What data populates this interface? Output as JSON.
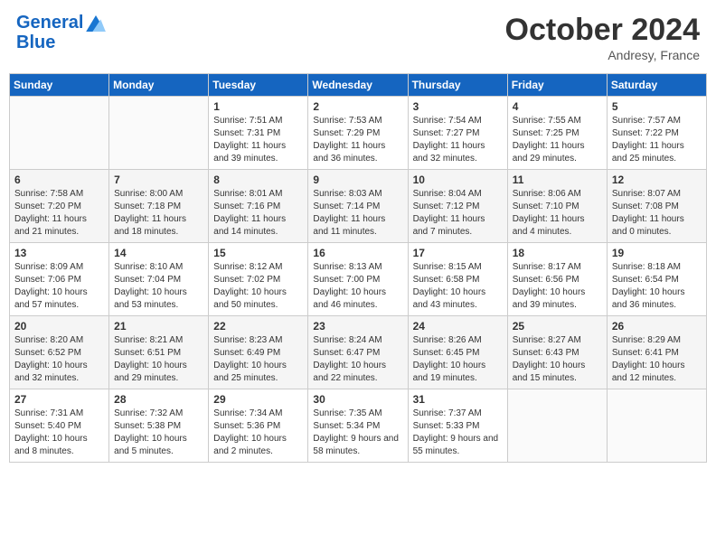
{
  "header": {
    "logo_line1": "General",
    "logo_line2": "Blue",
    "month": "October 2024",
    "location": "Andresy, France"
  },
  "weekdays": [
    "Sunday",
    "Monday",
    "Tuesday",
    "Wednesday",
    "Thursday",
    "Friday",
    "Saturday"
  ],
  "weeks": [
    [
      {
        "day": "",
        "info": ""
      },
      {
        "day": "",
        "info": ""
      },
      {
        "day": "1",
        "info": "Sunrise: 7:51 AM\nSunset: 7:31 PM\nDaylight: 11 hours and 39 minutes."
      },
      {
        "day": "2",
        "info": "Sunrise: 7:53 AM\nSunset: 7:29 PM\nDaylight: 11 hours and 36 minutes."
      },
      {
        "day": "3",
        "info": "Sunrise: 7:54 AM\nSunset: 7:27 PM\nDaylight: 11 hours and 32 minutes."
      },
      {
        "day": "4",
        "info": "Sunrise: 7:55 AM\nSunset: 7:25 PM\nDaylight: 11 hours and 29 minutes."
      },
      {
        "day": "5",
        "info": "Sunrise: 7:57 AM\nSunset: 7:22 PM\nDaylight: 11 hours and 25 minutes."
      }
    ],
    [
      {
        "day": "6",
        "info": "Sunrise: 7:58 AM\nSunset: 7:20 PM\nDaylight: 11 hours and 21 minutes."
      },
      {
        "day": "7",
        "info": "Sunrise: 8:00 AM\nSunset: 7:18 PM\nDaylight: 11 hours and 18 minutes."
      },
      {
        "day": "8",
        "info": "Sunrise: 8:01 AM\nSunset: 7:16 PM\nDaylight: 11 hours and 14 minutes."
      },
      {
        "day": "9",
        "info": "Sunrise: 8:03 AM\nSunset: 7:14 PM\nDaylight: 11 hours and 11 minutes."
      },
      {
        "day": "10",
        "info": "Sunrise: 8:04 AM\nSunset: 7:12 PM\nDaylight: 11 hours and 7 minutes."
      },
      {
        "day": "11",
        "info": "Sunrise: 8:06 AM\nSunset: 7:10 PM\nDaylight: 11 hours and 4 minutes."
      },
      {
        "day": "12",
        "info": "Sunrise: 8:07 AM\nSunset: 7:08 PM\nDaylight: 11 hours and 0 minutes."
      }
    ],
    [
      {
        "day": "13",
        "info": "Sunrise: 8:09 AM\nSunset: 7:06 PM\nDaylight: 10 hours and 57 minutes."
      },
      {
        "day": "14",
        "info": "Sunrise: 8:10 AM\nSunset: 7:04 PM\nDaylight: 10 hours and 53 minutes."
      },
      {
        "day": "15",
        "info": "Sunrise: 8:12 AM\nSunset: 7:02 PM\nDaylight: 10 hours and 50 minutes."
      },
      {
        "day": "16",
        "info": "Sunrise: 8:13 AM\nSunset: 7:00 PM\nDaylight: 10 hours and 46 minutes."
      },
      {
        "day": "17",
        "info": "Sunrise: 8:15 AM\nSunset: 6:58 PM\nDaylight: 10 hours and 43 minutes."
      },
      {
        "day": "18",
        "info": "Sunrise: 8:17 AM\nSunset: 6:56 PM\nDaylight: 10 hours and 39 minutes."
      },
      {
        "day": "19",
        "info": "Sunrise: 8:18 AM\nSunset: 6:54 PM\nDaylight: 10 hours and 36 minutes."
      }
    ],
    [
      {
        "day": "20",
        "info": "Sunrise: 8:20 AM\nSunset: 6:52 PM\nDaylight: 10 hours and 32 minutes."
      },
      {
        "day": "21",
        "info": "Sunrise: 8:21 AM\nSunset: 6:51 PM\nDaylight: 10 hours and 29 minutes."
      },
      {
        "day": "22",
        "info": "Sunrise: 8:23 AM\nSunset: 6:49 PM\nDaylight: 10 hours and 25 minutes."
      },
      {
        "day": "23",
        "info": "Sunrise: 8:24 AM\nSunset: 6:47 PM\nDaylight: 10 hours and 22 minutes."
      },
      {
        "day": "24",
        "info": "Sunrise: 8:26 AM\nSunset: 6:45 PM\nDaylight: 10 hours and 19 minutes."
      },
      {
        "day": "25",
        "info": "Sunrise: 8:27 AM\nSunset: 6:43 PM\nDaylight: 10 hours and 15 minutes."
      },
      {
        "day": "26",
        "info": "Sunrise: 8:29 AM\nSunset: 6:41 PM\nDaylight: 10 hours and 12 minutes."
      }
    ],
    [
      {
        "day": "27",
        "info": "Sunrise: 7:31 AM\nSunset: 5:40 PM\nDaylight: 10 hours and 8 minutes."
      },
      {
        "day": "28",
        "info": "Sunrise: 7:32 AM\nSunset: 5:38 PM\nDaylight: 10 hours and 5 minutes."
      },
      {
        "day": "29",
        "info": "Sunrise: 7:34 AM\nSunset: 5:36 PM\nDaylight: 10 hours and 2 minutes."
      },
      {
        "day": "30",
        "info": "Sunrise: 7:35 AM\nSunset: 5:34 PM\nDaylight: 9 hours and 58 minutes."
      },
      {
        "day": "31",
        "info": "Sunrise: 7:37 AM\nSunset: 5:33 PM\nDaylight: 9 hours and 55 minutes."
      },
      {
        "day": "",
        "info": ""
      },
      {
        "day": "",
        "info": ""
      }
    ]
  ]
}
